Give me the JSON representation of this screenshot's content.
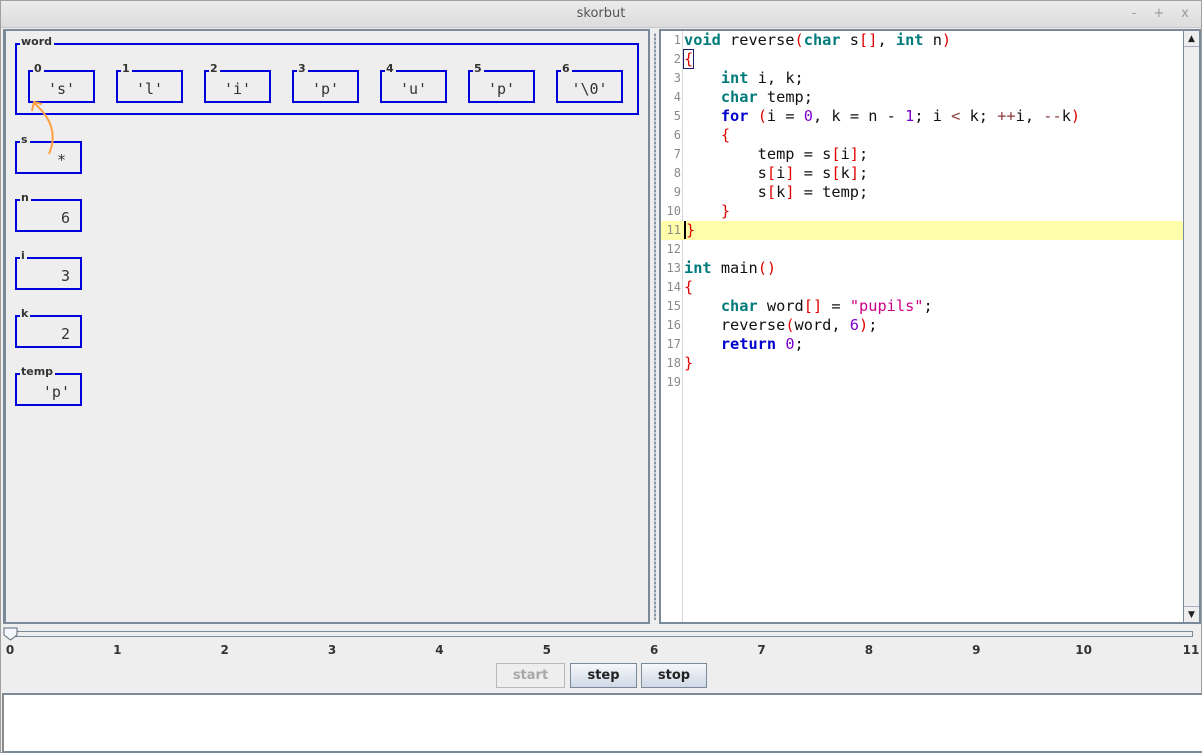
{
  "window": {
    "title": "skorbut",
    "controls": {
      "minimize": "-",
      "maximize": "+",
      "close": "x"
    }
  },
  "memory": {
    "array": {
      "name": "word",
      "cells": [
        {
          "index": "0",
          "value": "'s'"
        },
        {
          "index": "1",
          "value": "'l'"
        },
        {
          "index": "2",
          "value": "'i'"
        },
        {
          "index": "3",
          "value": "'p'"
        },
        {
          "index": "4",
          "value": "'u'"
        },
        {
          "index": "5",
          "value": "'p'"
        },
        {
          "index": "6",
          "value": "'\\0'"
        }
      ]
    },
    "variables": [
      {
        "name": "s",
        "value": "*",
        "points_to": "word[0]"
      },
      {
        "name": "n",
        "value": "6"
      },
      {
        "name": "i",
        "value": "3"
      },
      {
        "name": "k",
        "value": "2"
      },
      {
        "name": "temp",
        "value": "'p'"
      }
    ],
    "colors": {
      "box_border": "#0000dd",
      "pointer_arrow": "#ffa040"
    }
  },
  "editor": {
    "current_line": 11,
    "lines": [
      {
        "n": "1"
      },
      {
        "n": "2"
      },
      {
        "n": "3"
      },
      {
        "n": "4"
      },
      {
        "n": "5"
      },
      {
        "n": "6"
      },
      {
        "n": "7"
      },
      {
        "n": "8"
      },
      {
        "n": "9"
      },
      {
        "n": "10"
      },
      {
        "n": "11"
      },
      {
        "n": "12"
      },
      {
        "n": "13"
      },
      {
        "n": "14"
      },
      {
        "n": "15"
      },
      {
        "n": "16"
      },
      {
        "n": "17"
      },
      {
        "n": "18"
      },
      {
        "n": "19"
      }
    ],
    "tokens": {
      "l1": [
        "void",
        " reverse",
        "(",
        "char",
        " s",
        "[]",
        ", ",
        "int",
        " n",
        ")"
      ],
      "l2": [
        "{"
      ],
      "l3": [
        "    ",
        "int",
        " i, k;"
      ],
      "l4": [
        "    ",
        "char",
        " temp;"
      ],
      "l5": [
        "    ",
        "for",
        " ",
        "(",
        "i = ",
        "0",
        ", k = n - ",
        "1",
        "; i ",
        "<",
        " k; ",
        "++",
        "i, ",
        "--",
        "k",
        ")"
      ],
      "l6": [
        "    ",
        "{"
      ],
      "l7": [
        "        temp = s",
        "[",
        "i",
        "]",
        ";"
      ],
      "l8": [
        "        s",
        "[",
        "i",
        "]",
        " = s",
        "[",
        "k",
        "]",
        ";"
      ],
      "l9": [
        "        s",
        "[",
        "k",
        "]",
        " = temp;"
      ],
      "l10": [
        "    ",
        "}"
      ],
      "l11": [
        "}"
      ],
      "l12": [],
      "l13": [
        "int",
        " main",
        "()"
      ],
      "l14": [
        "{"
      ],
      "l15": [
        "    ",
        "char",
        " word",
        "[]",
        " = ",
        "\"pupils\"",
        ";"
      ],
      "l16": [
        "    reverse",
        "(",
        "word, ",
        "6",
        ")",
        ";"
      ],
      "l17": [
        "    ",
        "return",
        " ",
        "0",
        ";"
      ],
      "l18": [
        "}"
      ],
      "l19": []
    }
  },
  "timeline": {
    "min": 0,
    "max": 11,
    "value": 0,
    "ticks": [
      "0",
      "1",
      "2",
      "3",
      "4",
      "5",
      "6",
      "7",
      "8",
      "9",
      "10",
      "11"
    ]
  },
  "controls": {
    "start": {
      "label": "start",
      "enabled": false
    },
    "step": {
      "label": "step",
      "enabled": true
    },
    "stop": {
      "label": "stop",
      "enabled": true
    }
  },
  "output": {
    "text": ""
  }
}
